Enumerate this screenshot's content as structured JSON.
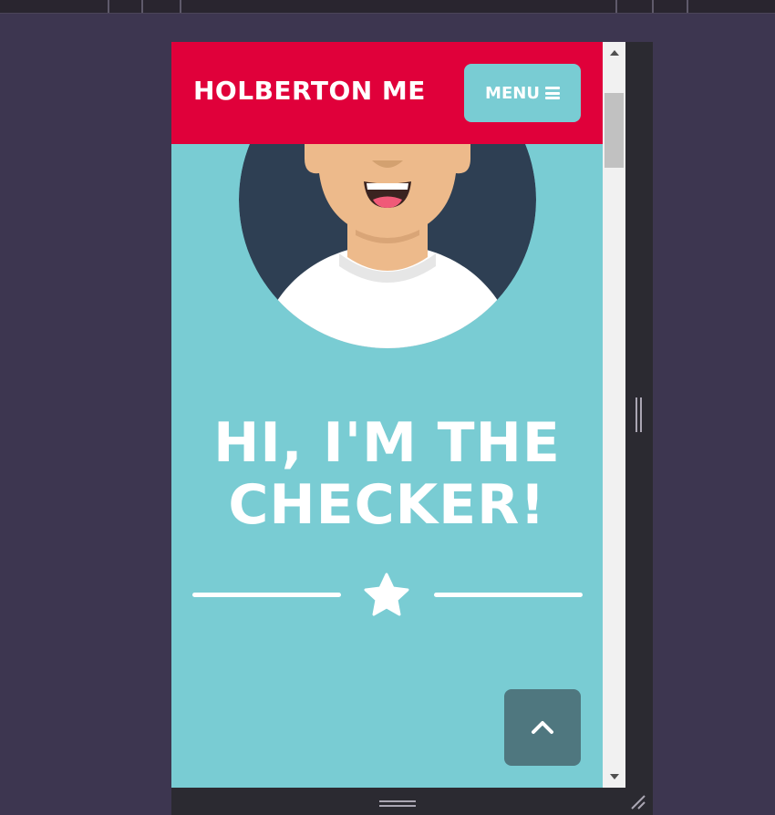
{
  "site": {
    "brand": "HOLBERTON ME",
    "menu_label": "MENU",
    "headline_line1": "HI, I'M THE",
    "headline_line2": "CHECKER!"
  },
  "icons": {
    "menu": "hamburger-icon",
    "divider": "star-icon",
    "back_to_top": "chevron-up-icon",
    "scroll_up": "triangle-up-icon",
    "scroll_down": "triangle-down-icon"
  },
  "colors": {
    "header": "#e0003a",
    "accent": "#79ccd3",
    "background": "#79ccd3",
    "text": "#ffffff",
    "back_to_top": "#4f777f",
    "page_bg": "#3d3650"
  }
}
